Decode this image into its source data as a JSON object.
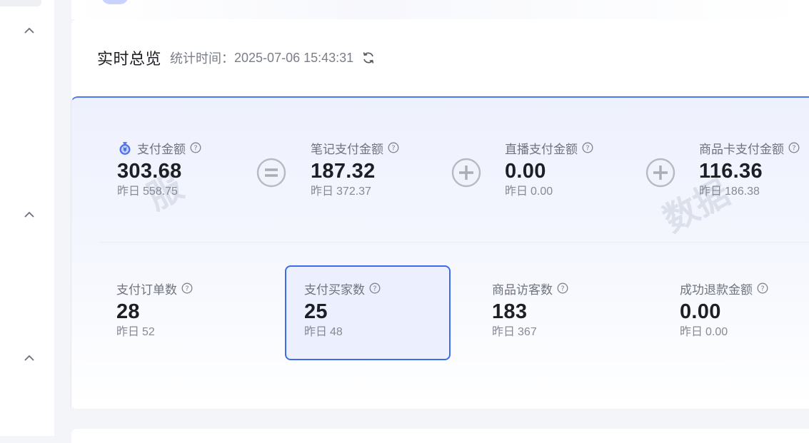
{
  "header": {
    "title": "实时总览",
    "stat_label": "统计时间：",
    "stat_time": "2025-07-06 15:43:31"
  },
  "row1": [
    {
      "label": "支付金额",
      "value": "303.68",
      "yesterday_label": "昨日",
      "yesterday_value": "558.75"
    },
    {
      "label": "笔记支付金额",
      "value": "187.32",
      "yesterday_label": "昨日",
      "yesterday_value": "372.37"
    },
    {
      "label": "直播支付金额",
      "value": "0.00",
      "yesterday_label": "昨日",
      "yesterday_value": "0.00"
    },
    {
      "label": "商品卡支付金额",
      "value": "116.36",
      "yesterday_label": "昨日",
      "yesterday_value": "186.38"
    }
  ],
  "row2": [
    {
      "label": "支付订单数",
      "value": "28",
      "yesterday_label": "昨日",
      "yesterday_value": "52"
    },
    {
      "label": "支付买家数",
      "value": "25",
      "yesterday_label": "昨日",
      "yesterday_value": "48"
    },
    {
      "label": "商品访客数",
      "value": "183",
      "yesterday_label": "昨日",
      "yesterday_value": "367"
    },
    {
      "label": "成功退款金额",
      "value": "0.00",
      "yesterday_label": "昨日",
      "yesterday_value": "0.00"
    }
  ],
  "watermark": {
    "left": "服",
    "right": "数据"
  },
  "colors": {
    "accent": "#3e6be8",
    "title": "#1d1f24",
    "muted": "#868a93"
  },
  "icons": {
    "collapse": "chevron-up-icon",
    "refresh": "refresh-icon",
    "help": "question-circle-icon",
    "money": "money-bag-icon",
    "equals": "equals-circle-icon",
    "plus": "plus-circle-icon"
  }
}
